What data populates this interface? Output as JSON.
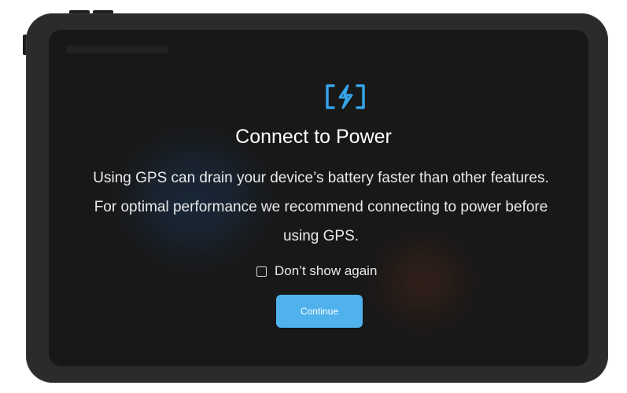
{
  "dialog": {
    "icon": "charging-bolt-icon",
    "title": "Connect to Power",
    "body_line1": "Using GPS can drain your device’s battery faster than other features.",
    "body_line2": "For optimal performance we recommend connecting to power before",
    "body_line3": "using GPS.",
    "checkbox_label": "Don’t show again",
    "checkbox_checked": false,
    "continue_label": "Continue"
  },
  "colors": {
    "accent": "#4fb2ec",
    "icon": "#35a3e8",
    "screen_background": "#181818",
    "device_frame": "#2b2b2b"
  }
}
